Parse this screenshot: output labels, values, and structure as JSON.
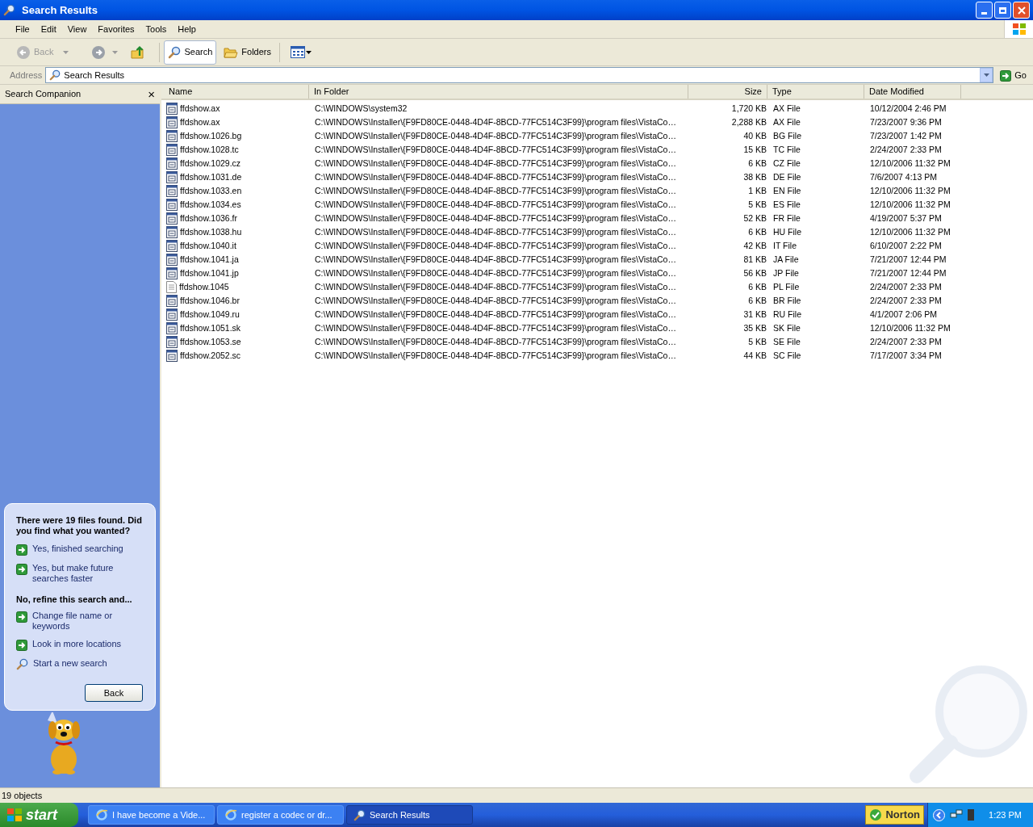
{
  "window": {
    "title": "Search Results"
  },
  "menu": [
    "File",
    "Edit",
    "View",
    "Favorites",
    "Tools",
    "Help"
  ],
  "toolbar": [
    {
      "kind": "back",
      "label": "Back",
      "disabled": true
    },
    {
      "kind": "forward",
      "disabled": false
    },
    {
      "kind": "up",
      "disabled": false
    },
    {
      "kind": "search",
      "label": "Search",
      "selected": true
    },
    {
      "kind": "folders",
      "label": "Folders",
      "selected": false
    },
    {
      "kind": "views",
      "disabled": false
    }
  ],
  "address": {
    "label": "Address",
    "value": "Search Results",
    "go": "Go"
  },
  "companion": {
    "title": "Search Companion",
    "close": "×",
    "heading": "There were 19 files found. Did you find what you wanted?",
    "links": [
      {
        "kind": "arrow",
        "text": "Yes, finished searching"
      },
      {
        "kind": "arrow",
        "text": "Yes, but make future searches faster"
      },
      {
        "kind": "heading",
        "text": "No, refine this search and..."
      },
      {
        "kind": "arrow",
        "text": "Change file name or keywords"
      },
      {
        "kind": "arrow",
        "text": "Look in more locations"
      },
      {
        "kind": "search",
        "text": "Start a new search"
      }
    ],
    "back": "Back"
  },
  "table": {
    "columns": [
      "Name",
      "In Folder",
      "Size",
      "Type",
      "Date Modified"
    ],
    "rows": [
      {
        "kind": "binary",
        "name": "ffdshow.ax",
        "folder": "C:\\WINDOWS\\system32",
        "size": "1,720 KB",
        "type": "AX File",
        "date": "10/12/2004 2:46 PM"
      },
      {
        "kind": "binary",
        "name": "ffdshow.ax",
        "folder": "C:\\WINDOWS\\Installer\\{F9FD80CE-0448-4D4F-8BCD-77FC514C3F99}\\program files\\VistaCo…",
        "size": "2,288 KB",
        "type": "AX File",
        "date": "7/23/2007 9:36 PM"
      },
      {
        "kind": "binary",
        "name": "ffdshow.1026.bg",
        "folder": "C:\\WINDOWS\\Installer\\{F9FD80CE-0448-4D4F-8BCD-77FC514C3F99}\\program files\\VistaCo…",
        "size": "40 KB",
        "type": "BG File",
        "date": "7/23/2007 1:42 PM"
      },
      {
        "kind": "binary",
        "name": "ffdshow.1028.tc",
        "folder": "C:\\WINDOWS\\Installer\\{F9FD80CE-0448-4D4F-8BCD-77FC514C3F99}\\program files\\VistaCo…",
        "size": "15 KB",
        "type": "TC File",
        "date": "2/24/2007 2:33 PM"
      },
      {
        "kind": "binary",
        "name": "ffdshow.1029.cz",
        "folder": "C:\\WINDOWS\\Installer\\{F9FD80CE-0448-4D4F-8BCD-77FC514C3F99}\\program files\\VistaCo…",
        "size": "6 KB",
        "type": "CZ File",
        "date": "12/10/2006 11:32 PM"
      },
      {
        "kind": "binary",
        "name": "ffdshow.1031.de",
        "folder": "C:\\WINDOWS\\Installer\\{F9FD80CE-0448-4D4F-8BCD-77FC514C3F99}\\program files\\VistaCo…",
        "size": "38 KB",
        "type": "DE File",
        "date": "7/6/2007 4:13 PM"
      },
      {
        "kind": "binary",
        "name": "ffdshow.1033.en",
        "folder": "C:\\WINDOWS\\Installer\\{F9FD80CE-0448-4D4F-8BCD-77FC514C3F99}\\program files\\VistaCo…",
        "size": "1 KB",
        "type": "EN File",
        "date": "12/10/2006 11:32 PM"
      },
      {
        "kind": "binary",
        "name": "ffdshow.1034.es",
        "folder": "C:\\WINDOWS\\Installer\\{F9FD80CE-0448-4D4F-8BCD-77FC514C3F99}\\program files\\VistaCo…",
        "size": "5 KB",
        "type": "ES File",
        "date": "12/10/2006 11:32 PM"
      },
      {
        "kind": "binary",
        "name": "ffdshow.1036.fr",
        "folder": "C:\\WINDOWS\\Installer\\{F9FD80CE-0448-4D4F-8BCD-77FC514C3F99}\\program files\\VistaCo…",
        "size": "52 KB",
        "type": "FR File",
        "date": "4/19/2007 5:37 PM"
      },
      {
        "kind": "binary",
        "name": "ffdshow.1038.hu",
        "folder": "C:\\WINDOWS\\Installer\\{F9FD80CE-0448-4D4F-8BCD-77FC514C3F99}\\program files\\VistaCo…",
        "size": "6 KB",
        "type": "HU File",
        "date": "12/10/2006 11:32 PM"
      },
      {
        "kind": "binary",
        "name": "ffdshow.1040.it",
        "folder": "C:\\WINDOWS\\Installer\\{F9FD80CE-0448-4D4F-8BCD-77FC514C3F99}\\program files\\VistaCo…",
        "size": "42 KB",
        "type": "IT File",
        "date": "6/10/2007 2:22 PM"
      },
      {
        "kind": "binary",
        "name": "ffdshow.1041.ja",
        "folder": "C:\\WINDOWS\\Installer\\{F9FD80CE-0448-4D4F-8BCD-77FC514C3F99}\\program files\\VistaCo…",
        "size": "81 KB",
        "type": "JA File",
        "date": "7/21/2007 12:44 PM"
      },
      {
        "kind": "binary",
        "name": "ffdshow.1041.jp",
        "folder": "C:\\WINDOWS\\Installer\\{F9FD80CE-0448-4D4F-8BCD-77FC514C3F99}\\program files\\VistaCo…",
        "size": "56 KB",
        "type": "JP File",
        "date": "7/21/2007 12:44 PM"
      },
      {
        "kind": "text",
        "name": "ffdshow.1045",
        "folder": "C:\\WINDOWS\\Installer\\{F9FD80CE-0448-4D4F-8BCD-77FC514C3F99}\\program files\\VistaCo…",
        "size": "6 KB",
        "type": "PL File",
        "date": "2/24/2007 2:33 PM"
      },
      {
        "kind": "binary",
        "name": "ffdshow.1046.br",
        "folder": "C:\\WINDOWS\\Installer\\{F9FD80CE-0448-4D4F-8BCD-77FC514C3F99}\\program files\\VistaCo…",
        "size": "6 KB",
        "type": "BR File",
        "date": "2/24/2007 2:33 PM"
      },
      {
        "kind": "binary",
        "name": "ffdshow.1049.ru",
        "folder": "C:\\WINDOWS\\Installer\\{F9FD80CE-0448-4D4F-8BCD-77FC514C3F99}\\program files\\VistaCo…",
        "size": "31 KB",
        "type": "RU File",
        "date": "4/1/2007 2:06 PM"
      },
      {
        "kind": "binary",
        "name": "ffdshow.1051.sk",
        "folder": "C:\\WINDOWS\\Installer\\{F9FD80CE-0448-4D4F-8BCD-77FC514C3F99}\\program files\\VistaCo…",
        "size": "35 KB",
        "type": "SK File",
        "date": "12/10/2006 11:32 PM"
      },
      {
        "kind": "binary",
        "name": "ffdshow.1053.se",
        "folder": "C:\\WINDOWS\\Installer\\{F9FD80CE-0448-4D4F-8BCD-77FC514C3F99}\\program files\\VistaCo…",
        "size": "5 KB",
        "type": "SE File",
        "date": "2/24/2007 2:33 PM"
      },
      {
        "kind": "binary",
        "name": "ffdshow.2052.sc",
        "folder": "C:\\WINDOWS\\Installer\\{F9FD80CE-0448-4D4F-8BCD-77FC514C3F99}\\program files\\VistaCo…",
        "size": "44 KB",
        "type": "SC File",
        "date": "7/17/2007 3:34 PM"
      }
    ]
  },
  "status_bar": "19 objects",
  "taskbar": {
    "start": "start",
    "items": [
      {
        "kind": "browser",
        "label": "I have become a Vide...",
        "selected": false
      },
      {
        "kind": "browser",
        "label": "register a codec or dr...",
        "selected": false
      },
      {
        "kind": "search",
        "label": "Search Results",
        "selected": true
      }
    ],
    "norton": "Norton",
    "clock": "1:23 PM"
  }
}
